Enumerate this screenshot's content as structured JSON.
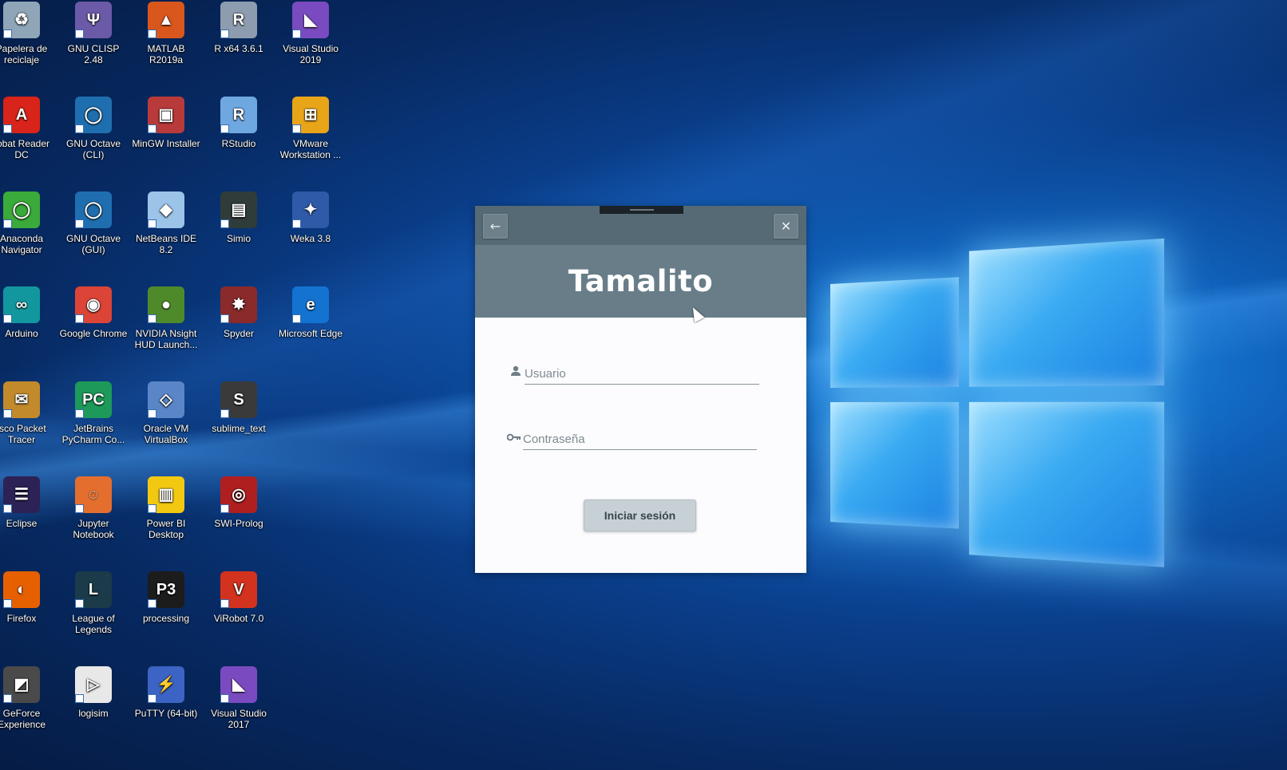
{
  "desktop": {
    "icons": [
      {
        "label": "Papelera de reciclaje",
        "icon": "recycle-bin-icon",
        "color": "#8fa6b8",
        "glyph": "♻"
      },
      {
        "label": "GNU CLISP 2.48",
        "icon": "clisp-icon",
        "color": "#6b5aa8",
        "glyph": "Ψ"
      },
      {
        "label": "MATLAB R2019a",
        "icon": "matlab-icon",
        "color": "#d9561c",
        "glyph": "▲"
      },
      {
        "label": "R x64 3.6.1",
        "icon": "r-icon",
        "color": "#8e9cb0",
        "glyph": "R"
      },
      {
        "label": "Visual Studio 2019",
        "icon": "visual-studio-icon",
        "color": "#7a4bc0",
        "glyph": "◣"
      },
      {
        "label": "robat Reader DC",
        "icon": "acrobat-icon",
        "color": "#d8241a",
        "glyph": "A"
      },
      {
        "label": "GNU Octave (CLI)",
        "icon": "octave-icon",
        "color": "#1f6fb0",
        "glyph": "◯"
      },
      {
        "label": "MinGW Installer",
        "icon": "mingw-icon",
        "color": "#b83a3a",
        "glyph": "▣"
      },
      {
        "label": "RStudio",
        "icon": "rstudio-icon",
        "color": "#6fa7e0",
        "glyph": "R"
      },
      {
        "label": "VMware Workstation ...",
        "icon": "vmware-icon",
        "color": "#e8a518",
        "glyph": "⊞"
      },
      {
        "label": "Anaconda Navigator",
        "icon": "anaconda-icon",
        "color": "#3aaa3a",
        "glyph": "◯"
      },
      {
        "label": "GNU Octave (GUI)",
        "icon": "octave-gui-icon",
        "color": "#1f6fb0",
        "glyph": "◯"
      },
      {
        "label": "NetBeans IDE 8.2",
        "icon": "netbeans-icon",
        "color": "#9cc3e8",
        "glyph": "◆"
      },
      {
        "label": "Simio",
        "icon": "simio-icon",
        "color": "#2f3c3a",
        "glyph": "▤"
      },
      {
        "label": "Weka 3.8",
        "icon": "weka-icon",
        "color": "#2e5aa8",
        "glyph": "✦"
      },
      {
        "label": "Arduino",
        "icon": "arduino-icon",
        "color": "#13979f",
        "glyph": "∞"
      },
      {
        "label": "Google Chrome",
        "icon": "chrome-icon",
        "color": "#db4437",
        "glyph": "◉"
      },
      {
        "label": "NVIDIA Nsight HUD Launch...",
        "icon": "nvidia-nsight-icon",
        "color": "#4f8a2a",
        "glyph": "●"
      },
      {
        "label": "Spyder",
        "icon": "spyder-icon",
        "color": "#8a2a2a",
        "glyph": "✸"
      },
      {
        "label": "Microsoft Edge",
        "icon": "edge-icon",
        "color": "#1473d0",
        "glyph": "e"
      },
      {
        "label": "isco Packet Tracer",
        "icon": "packet-tracer-icon",
        "color": "#c28a2a",
        "glyph": "✉"
      },
      {
        "label": "JetBrains PyCharm Co...",
        "icon": "pycharm-icon",
        "color": "#1d9a5a",
        "glyph": "PC"
      },
      {
        "label": "Oracle VM VirtualBox",
        "icon": "virtualbox-icon",
        "color": "#5a86c8",
        "glyph": "◇"
      },
      {
        "label": "sublime_text",
        "icon": "sublime-icon",
        "color": "#3a3a3a",
        "glyph": "S"
      },
      {
        "label": "",
        "icon": "",
        "color": "",
        "glyph": ""
      },
      {
        "label": "Eclipse",
        "icon": "eclipse-icon",
        "color": "#2c2255",
        "glyph": "☰"
      },
      {
        "label": "Jupyter Notebook",
        "icon": "jupyter-icon",
        "color": "#e46e2e",
        "glyph": "◌"
      },
      {
        "label": "Power BI Desktop",
        "icon": "powerbi-icon",
        "color": "#f2c811",
        "glyph": "▥"
      },
      {
        "label": "SWI-Prolog",
        "icon": "swi-prolog-icon",
        "color": "#b01f1f",
        "glyph": "◎"
      },
      {
        "label": "",
        "icon": "",
        "color": "",
        "glyph": ""
      },
      {
        "label": "Firefox",
        "icon": "firefox-icon",
        "color": "#e66000",
        "glyph": "◐"
      },
      {
        "label": "League of Legends",
        "icon": "league-icon",
        "color": "#1b3a4a",
        "glyph": "L"
      },
      {
        "label": "processing",
        "icon": "processing-icon",
        "color": "#1c1c1c",
        "glyph": "P3"
      },
      {
        "label": "ViRobot 7.0",
        "icon": "virobot-icon",
        "color": "#d2321e",
        "glyph": "V"
      },
      {
        "label": "",
        "icon": "",
        "color": "",
        "glyph": ""
      },
      {
        "label": "GeForce Experience",
        "icon": "geforce-icon",
        "color": "#4a4a4a",
        "glyph": "◩"
      },
      {
        "label": "logisim",
        "icon": "logisim-icon",
        "color": "#e8e8e8",
        "glyph": "▷"
      },
      {
        "label": "PuTTY (64-bit)",
        "icon": "putty-icon",
        "color": "#3b64c4",
        "glyph": "⚡"
      },
      {
        "label": "Visual Studio 2017",
        "icon": "visual-studio-2017-icon",
        "color": "#7a4bc0",
        "glyph": "◣"
      },
      {
        "label": "",
        "icon": "",
        "color": "",
        "glyph": ""
      }
    ]
  },
  "dialog": {
    "title": "Tamalito",
    "back_icon": "←",
    "close_icon": "✕",
    "username_placeholder": "Usuario",
    "username_value": "",
    "password_placeholder": "Contraseña",
    "password_value": "",
    "login_label": "Iniciar sesión",
    "user_icon": "👤",
    "key_icon": "⚷",
    "header_color": "#687d88",
    "titlebar_color": "#566a75"
  }
}
